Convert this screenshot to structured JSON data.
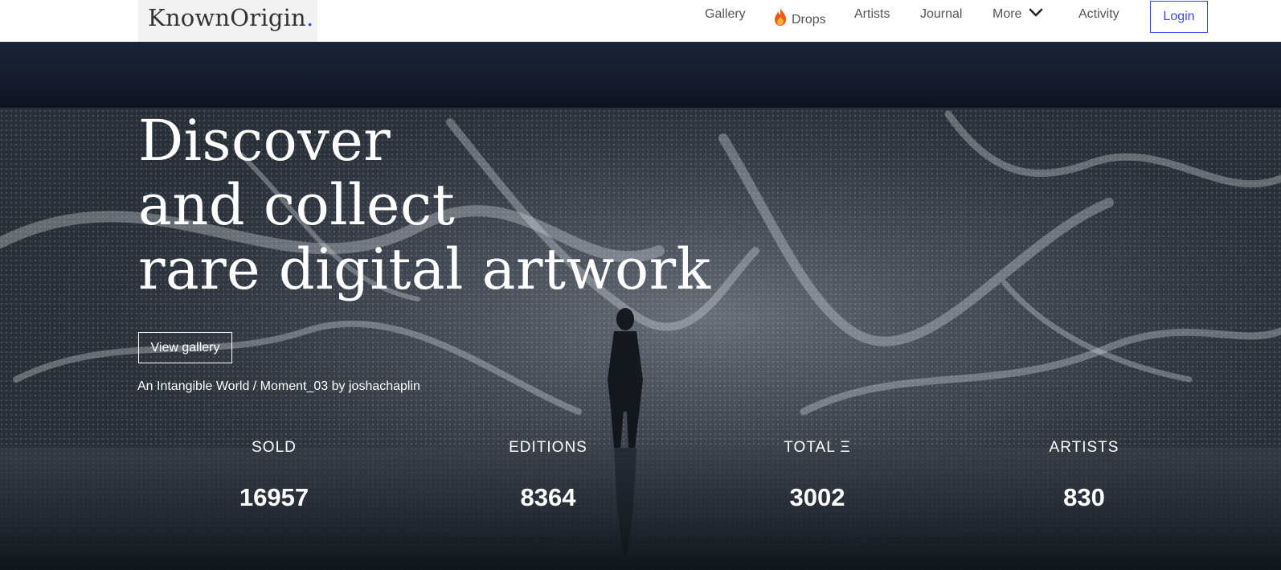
{
  "brand": {
    "name": "KnownOrigin",
    "dot": ".",
    "accent": "#3a48e8"
  },
  "nav": {
    "items": [
      {
        "label": "Gallery"
      },
      {
        "label": "Drops",
        "icon": "fire-icon"
      },
      {
        "label": "Artists"
      },
      {
        "label": "Journal"
      },
      {
        "label": "More",
        "icon": "chevron-down-icon"
      },
      {
        "label": "Activity"
      }
    ],
    "login_label": "Login"
  },
  "hero": {
    "headline": [
      "Discover",
      "and collect",
      "rare digital artwork"
    ],
    "cta_label": "View gallery",
    "credit": {
      "artwork": "An Intangible World / Moment_03",
      "by": "by",
      "artist": "joshachaplin"
    }
  },
  "stats": [
    {
      "label": "SOLD",
      "value": "16957"
    },
    {
      "label": "EDITIONS",
      "value": "8364"
    },
    {
      "label": "TOTAL Ξ",
      "value": "3002"
    },
    {
      "label": "ARTISTS",
      "value": "830"
    }
  ]
}
